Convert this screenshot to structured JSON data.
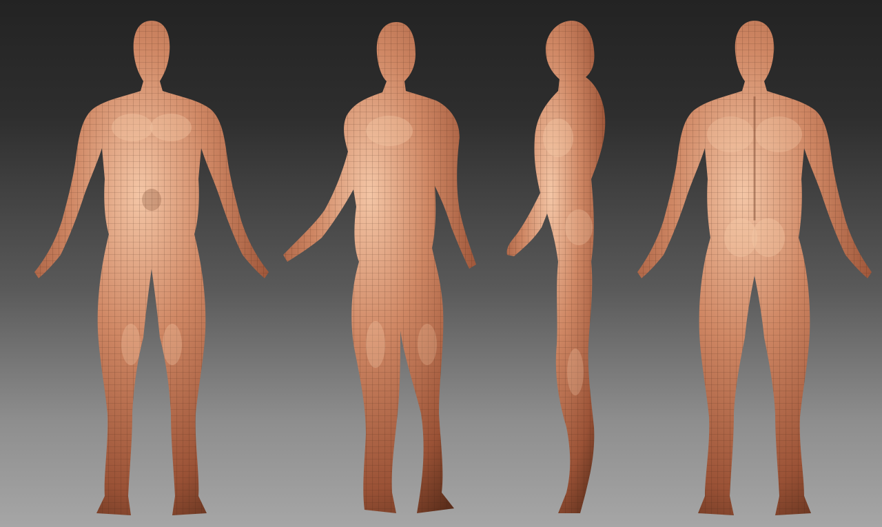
{
  "scene": {
    "description_type": "3d-sculpt-turnaround",
    "background_gradient": [
      "#232323",
      "#5a5a5a",
      "#a6a6a6"
    ],
    "skin_color": "#c9805e",
    "skin_highlight": "#f2c3a3",
    "skin_shadow": "#6e3a22",
    "wire_color": "#3a1e12"
  },
  "views": [
    {
      "name": "front"
    },
    {
      "name": "three-quarter"
    },
    {
      "name": "side"
    },
    {
      "name": "back"
    }
  ]
}
